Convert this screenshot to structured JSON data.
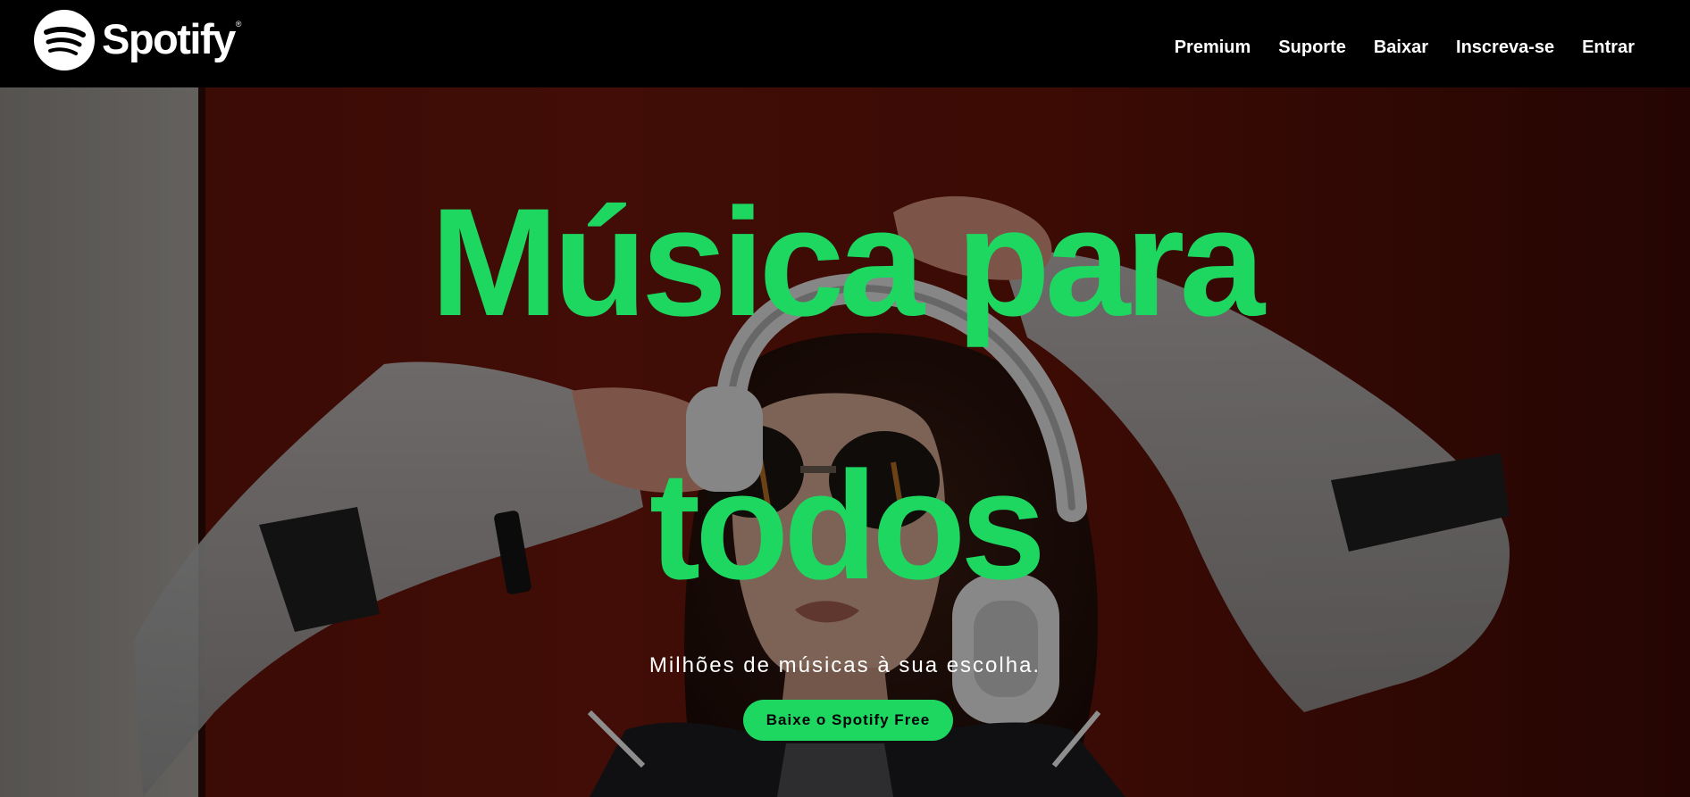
{
  "header": {
    "logo": {
      "wordmark": "Spotify",
      "registered": "®",
      "icon": "spotify-logo-icon"
    },
    "nav": [
      {
        "label": "Premium"
      },
      {
        "label": "Suporte"
      },
      {
        "label": "Baixar"
      },
      {
        "label": "Inscreva-se"
      },
      {
        "label": "Entrar"
      }
    ]
  },
  "hero": {
    "title_line1": "Música para",
    "title_line2": "todos",
    "subtitle": "Milhões de músicas à sua escolha.",
    "cta_label": "Baixe o Spotify Free",
    "background_image": "woman-with-headphones-photo"
  },
  "colors": {
    "brand_green": "#1ed760",
    "header_bg": "#000000",
    "hero_bg": "#4a0b05",
    "text_light": "#ffffff"
  }
}
